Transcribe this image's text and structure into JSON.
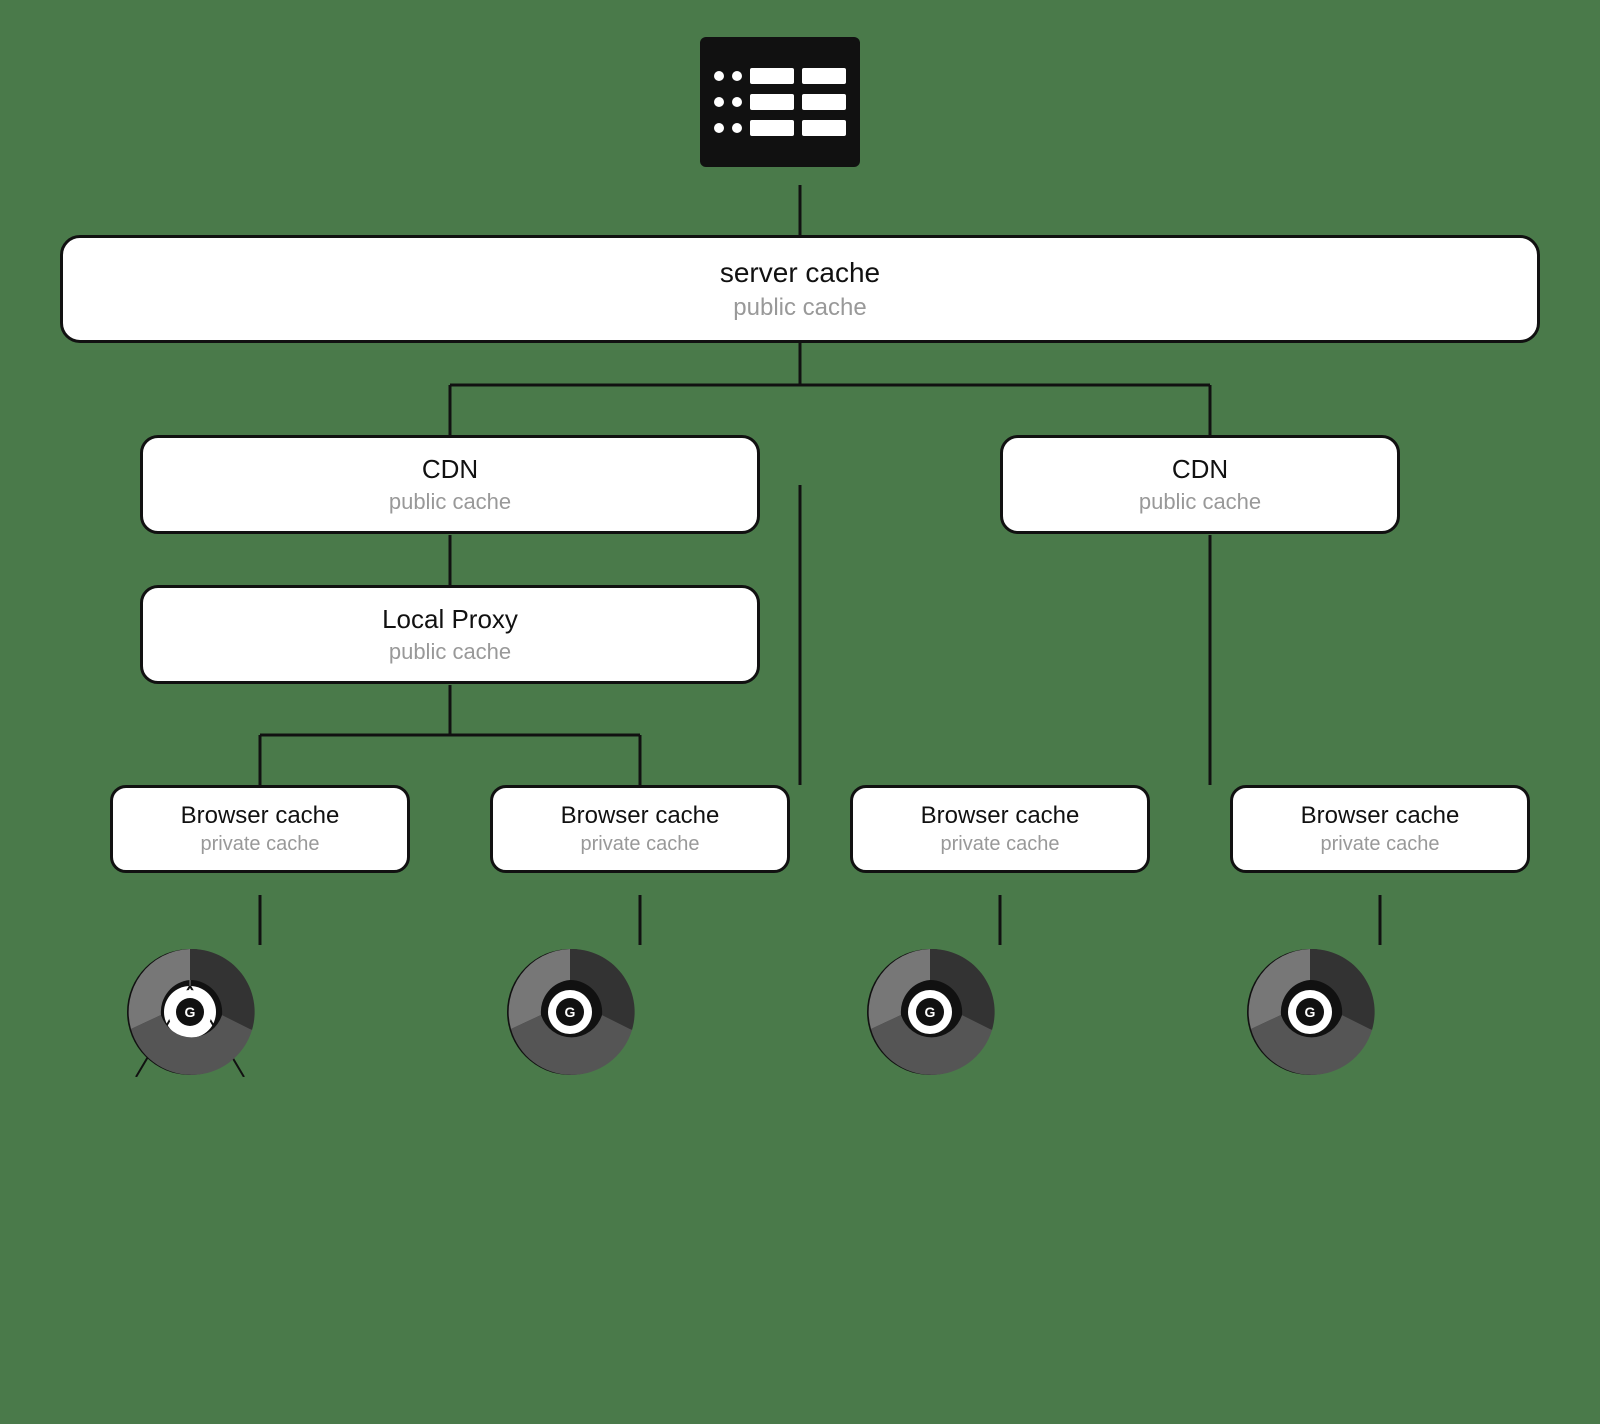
{
  "diagram": {
    "server": {
      "name": "server cache",
      "type": "public cache"
    },
    "cdn_left": {
      "name": "CDN",
      "type": "public cache"
    },
    "cdn_right": {
      "name": "CDN",
      "type": "public cache"
    },
    "local_proxy": {
      "name": "Local Proxy",
      "type": "public cache"
    },
    "browser_caches": [
      {
        "name": "Browser cache",
        "type": "private cache"
      },
      {
        "name": "Browser cache",
        "type": "private cache"
      },
      {
        "name": "Browser cache",
        "type": "private cache"
      },
      {
        "name": "Browser cache",
        "type": "private cache"
      }
    ]
  }
}
